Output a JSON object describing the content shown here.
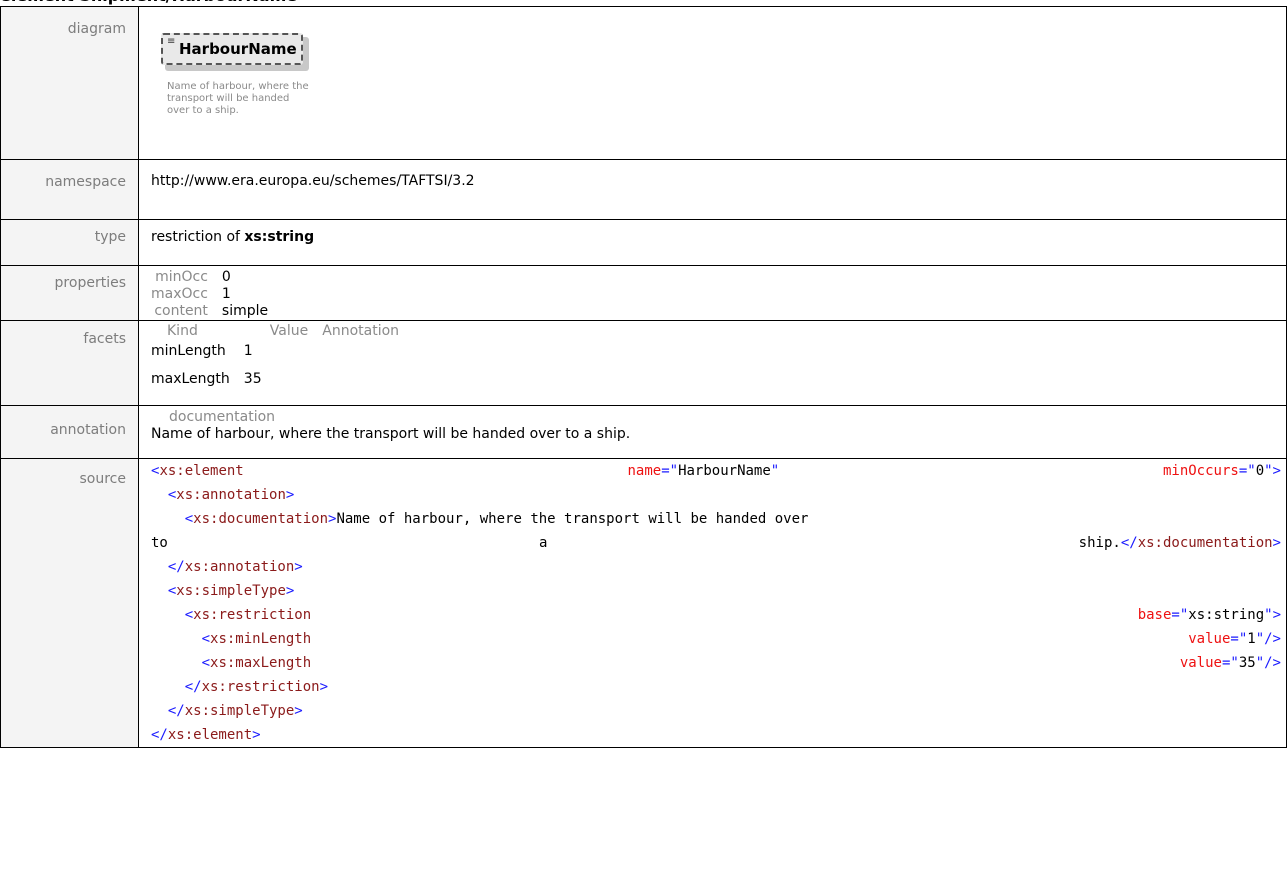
{
  "heading": "element Shipment/HarbourName",
  "rows": {
    "diagram": {
      "label": "diagram",
      "element_name": "HarbourName",
      "doc_lines": [
        "Name of harbour, where the",
        "transport will be handed",
        "over to a ship."
      ]
    },
    "namespace": {
      "label": "namespace",
      "value": "http://www.era.europa.eu/schemes/TAFTSI/3.2"
    },
    "type": {
      "label": "type",
      "prefix": "restriction of ",
      "base": "xs:string"
    },
    "properties": {
      "label": "properties",
      "items": [
        {
          "key": "minOcc",
          "value": "0"
        },
        {
          "key": "maxOcc",
          "value": "1"
        },
        {
          "key": "content",
          "value": "simple"
        }
      ]
    },
    "facets": {
      "label": "facets",
      "headers": [
        "Kind",
        "Value",
        "Annotation"
      ],
      "items": [
        {
          "kind": "minLength",
          "value": "1",
          "annotation": ""
        },
        {
          "kind": "maxLength",
          "value": "35",
          "annotation": ""
        }
      ]
    },
    "annotation": {
      "label": "annotation",
      "sub_label": "documentation",
      "text": "Name of harbour, where the transport will be handed over to a ship."
    },
    "source": {
      "label": "source",
      "element_tag": "xs:element",
      "name_attr": "name",
      "name_val": "HarbourName",
      "minocc_attr": "minOccurs",
      "minocc_val": "0",
      "annotation_tag": "xs:annotation",
      "documentation_tag": "xs:documentation",
      "doc_text_1": "Name of harbour, where the transport will be handed over",
      "doc_text_to": "to",
      "doc_text_a": "a",
      "doc_text_ship": "ship.",
      "simpletype_tag": "xs:simpleType",
      "restriction_tag": "xs:restriction",
      "base_attr": "base",
      "base_val": "xs:string",
      "minlength_tag": "xs:minLength",
      "maxlength_tag": "xs:maxLength",
      "value_attr": "value",
      "minlength_val": "1",
      "maxlength_val": "35"
    }
  }
}
